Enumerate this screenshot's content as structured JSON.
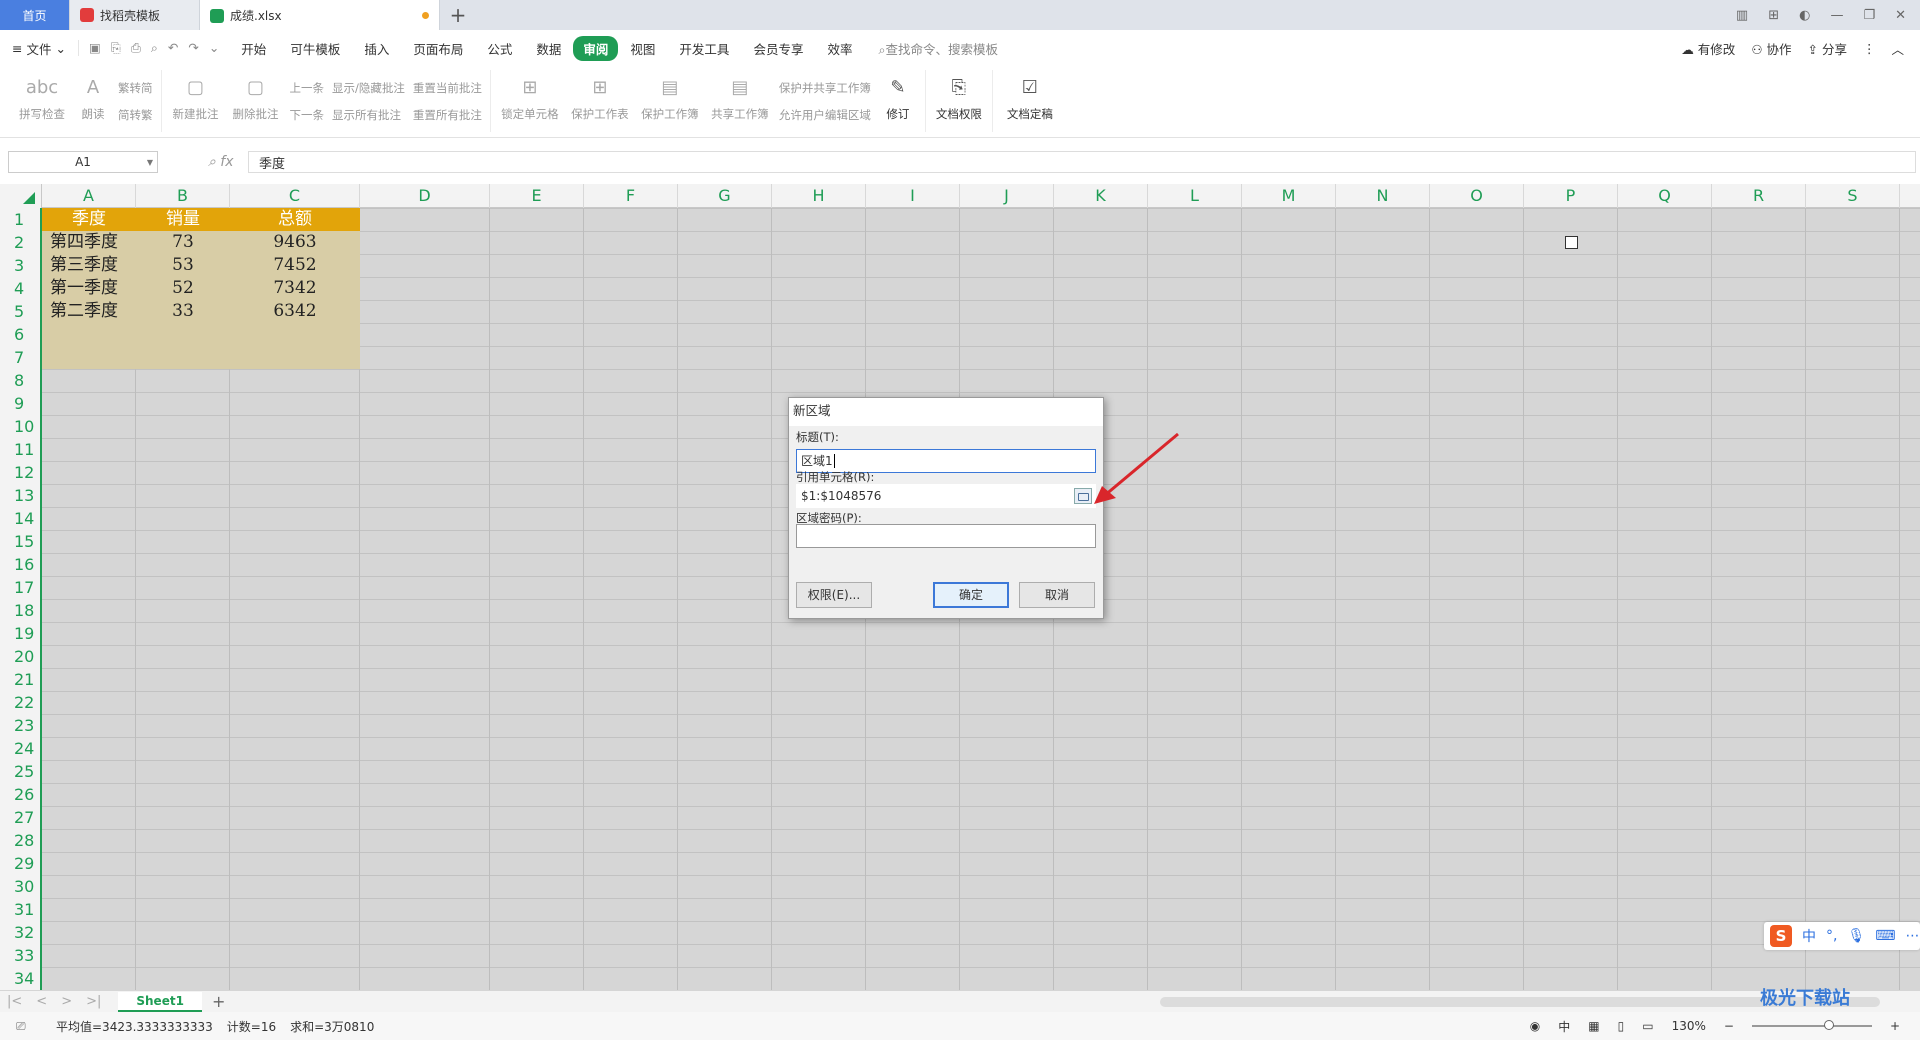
{
  "tabs": {
    "home": "首页",
    "template": "找稻壳模板",
    "file": "成绩.xlsx"
  },
  "menubar": {
    "file": "文件",
    "items": [
      "开始",
      "可牛模板",
      "插入",
      "页面布局",
      "公式",
      "数据",
      "审阅",
      "视图",
      "开发工具",
      "会员专享",
      "效率"
    ],
    "active": "审阅",
    "search": "查找命令、搜索模板",
    "right": {
      "modified": "有修改",
      "collab": "协作",
      "share": "分享"
    }
  },
  "ribbon": {
    "spell": "拼写检查",
    "read": "朗读",
    "trad": "繁转简",
    "simp": "简转繁",
    "new_comment": "新建批注",
    "del_comment": "删除批注",
    "prev": "上一条",
    "next": "下一条",
    "show_hide": "显示/隐藏批注",
    "show_all": "显示所有批注",
    "reset_current": "重置当前批注",
    "reset_all": "重置所有批注",
    "lock_cell": "锁定单元格",
    "protect_sheet": "保护工作表",
    "protect_book": "保护工作簿",
    "share_book": "共享工作簿",
    "protect_share": "保护并共享工作簿",
    "allow_edit": "允许用户编辑区域",
    "revise": "修订",
    "doc_perm": "文档权限",
    "doc_final": "文档定稿"
  },
  "formula": {
    "cell": "A1",
    "fx": "fx",
    "content": "季度"
  },
  "columns": [
    "A",
    "B",
    "C",
    "D",
    "E",
    "F",
    "G",
    "H",
    "I",
    "J",
    "K",
    "L",
    "M",
    "N",
    "O",
    "P",
    "Q",
    "R",
    "S"
  ],
  "rows": [
    "1",
    "2",
    "3",
    "4",
    "5",
    "6",
    "7",
    "8",
    "9",
    "10",
    "11",
    "12",
    "13",
    "14",
    "15",
    "16",
    "17",
    "18",
    "19",
    "20",
    "21",
    "22",
    "23",
    "24",
    "25",
    "26",
    "27",
    "28",
    "29",
    "30",
    "31",
    "32",
    "33",
    "34"
  ],
  "table": {
    "headers": [
      "季度",
      "销量",
      "总额"
    ],
    "rows": [
      [
        "第四季度",
        "73",
        "9463"
      ],
      [
        "第三季度",
        "53",
        "7452"
      ],
      [
        "第一季度",
        "52",
        "7342"
      ],
      [
        "第二季度",
        "33",
        "6342"
      ]
    ]
  },
  "dialog": {
    "title": "新区域",
    "title_label": "标题(T):",
    "title_value": "区域1",
    "ref_label": "引用单元格(R):",
    "ref_value": "$1:$1048576",
    "pwd_label": "区域密码(P):",
    "pwd_value": "",
    "perm_btn": "权限(E)...",
    "ok_btn": "确定",
    "cancel_btn": "取消"
  },
  "sheet_tab": "Sheet1",
  "status": {
    "avg": "平均值=3423.3333333333",
    "count": "计数=16",
    "sum": "求和=3万0810",
    "zoom": "130%",
    "ime_lang": "中"
  },
  "ime": {
    "logo": "S",
    "lang": "中",
    "punct": "°,"
  },
  "watermark": "极光下载站",
  "colors": {
    "accent": "#1f9d55",
    "header_fill": "#e2a40a",
    "table_fill": "#d8cda6"
  }
}
